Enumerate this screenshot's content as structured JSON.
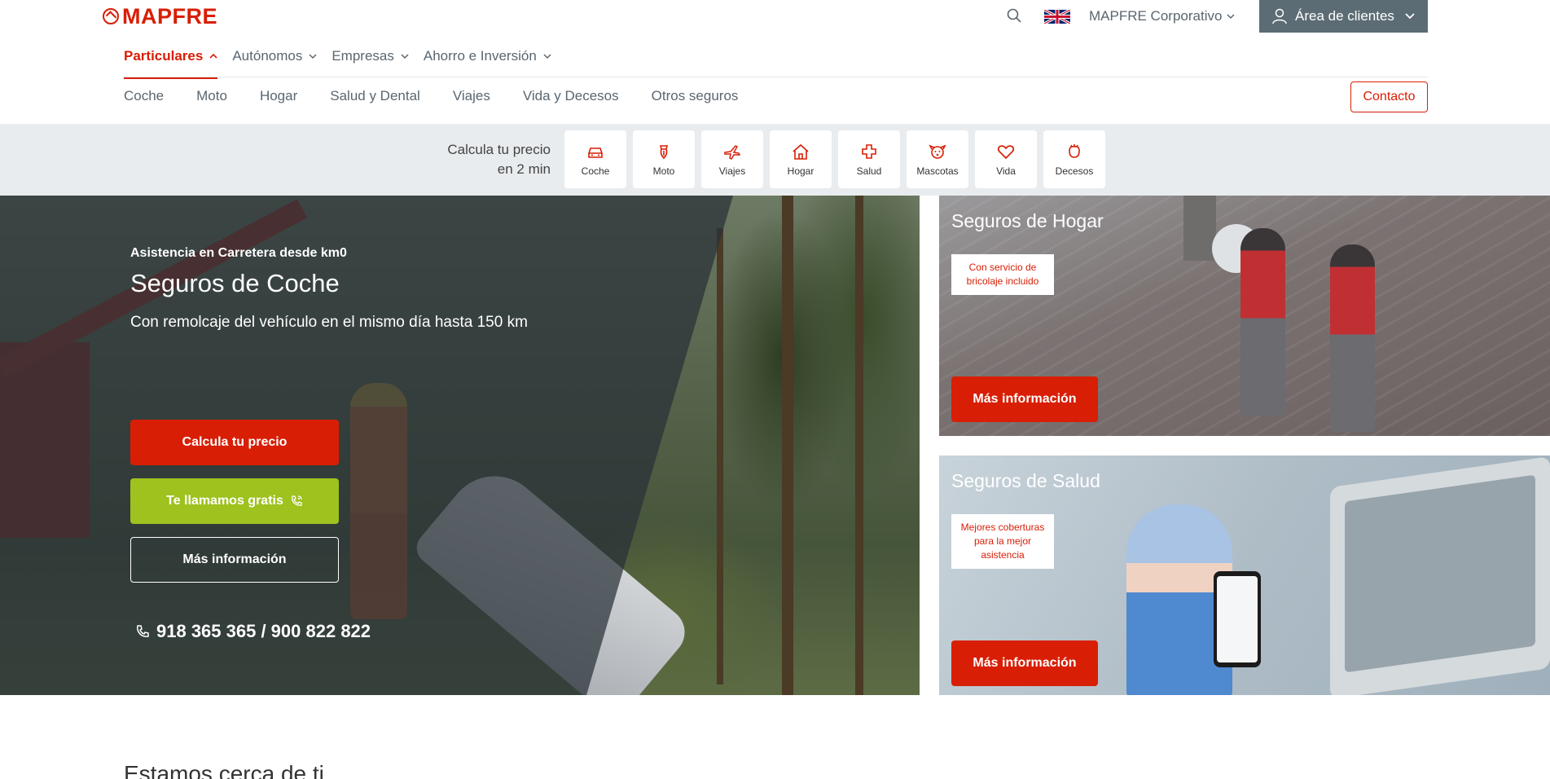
{
  "header": {
    "brand": "MAPFRE",
    "corporate_label": "MAPFRE Corporativo",
    "client_area_label": "Área de clientes"
  },
  "main_nav": [
    {
      "label": "Particulares",
      "active": true
    },
    {
      "label": "Autónomos",
      "active": false
    },
    {
      "label": "Empresas",
      "active": false
    },
    {
      "label": "Ahorro e Inversión",
      "active": false
    }
  ],
  "sub_nav": [
    "Coche",
    "Moto",
    "Hogar",
    "Salud y Dental",
    "Viajes",
    "Vida y Decesos",
    "Otros seguros"
  ],
  "contact_label": "Contacto",
  "quote": {
    "label_line1": "Calcula tu precio",
    "label_line2": "en 2 min",
    "cards": [
      {
        "label": "Coche",
        "icon": "car-icon"
      },
      {
        "label": "Moto",
        "icon": "motorcycle-icon"
      },
      {
        "label": "Viajes",
        "icon": "plane-icon"
      },
      {
        "label": "Hogar",
        "icon": "house-icon"
      },
      {
        "label": "Salud",
        "icon": "health-cross-icon"
      },
      {
        "label": "Mascotas",
        "icon": "pet-icon"
      },
      {
        "label": "Vida",
        "icon": "heart-icon"
      },
      {
        "label": "Decesos",
        "icon": "flower-icon"
      }
    ]
  },
  "hero": {
    "subtitle": "Asistencia en Carretera desde km0",
    "title": "Seguros de Coche",
    "description": "Con remolcaje del vehículo en el mismo día hasta 150 km",
    "btn_price": "Calcula tu precio",
    "btn_call": "Te llamamos gratis",
    "btn_info": "Más información",
    "phone": "918 365 365 / 900 822 822"
  },
  "side_cards": [
    {
      "title": "Seguros de Hogar",
      "tag": "Con servicio de bricolaje incluido",
      "button": "Más información"
    },
    {
      "title": "Seguros de Salud",
      "tag": "Mejores coberturas para la mejor asistencia",
      "button": "Más información"
    }
  ],
  "section_heading": "Estamos cerca de ti",
  "colors": {
    "brand_red": "#d81e05",
    "call_green": "#9ec21e",
    "client_area_bg": "#5c6c75",
    "quote_band_bg": "#e9ecee"
  }
}
